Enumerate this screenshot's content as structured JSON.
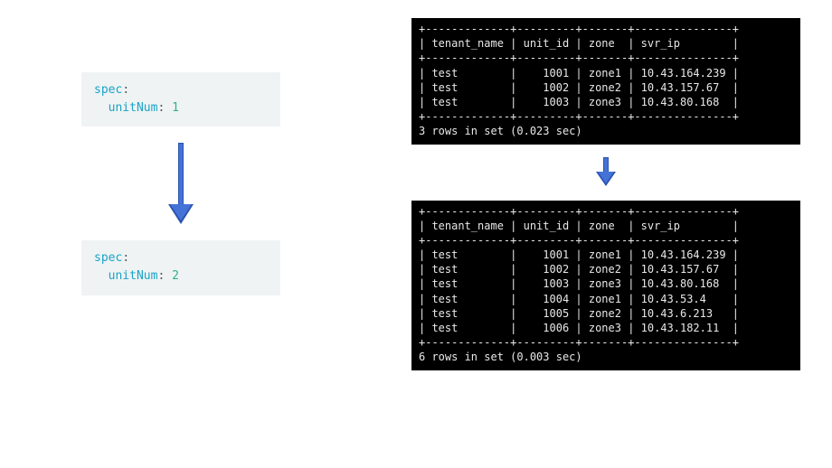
{
  "yaml_before": {
    "key1": "spec",
    "key2": "unitNum",
    "value": "1"
  },
  "yaml_after": {
    "key1": "spec",
    "key2": "unitNum",
    "value": "2"
  },
  "table_before": {
    "headers": [
      "tenant_name",
      "unit_id",
      "zone",
      "svr_ip"
    ],
    "rows": [
      [
        "test",
        "1001",
        "zone1",
        "10.43.164.239"
      ],
      [
        "test",
        "1002",
        "zone2",
        "10.43.157.67"
      ],
      [
        "test",
        "1003",
        "zone3",
        "10.43.80.168"
      ]
    ],
    "footer": "3 rows in set (0.023 sec)"
  },
  "table_after": {
    "headers": [
      "tenant_name",
      "unit_id",
      "zone",
      "svr_ip"
    ],
    "rows": [
      [
        "test",
        "1001",
        "zone1",
        "10.43.164.239"
      ],
      [
        "test",
        "1002",
        "zone2",
        "10.43.157.67"
      ],
      [
        "test",
        "1003",
        "zone3",
        "10.43.80.168"
      ],
      [
        "test",
        "1004",
        "zone1",
        "10.43.53.4"
      ],
      [
        "test",
        "1005",
        "zone2",
        "10.43.6.213"
      ],
      [
        "test",
        "1006",
        "zone3",
        "10.43.182.11"
      ]
    ],
    "footer": "6 rows in set (0.003 sec)"
  }
}
